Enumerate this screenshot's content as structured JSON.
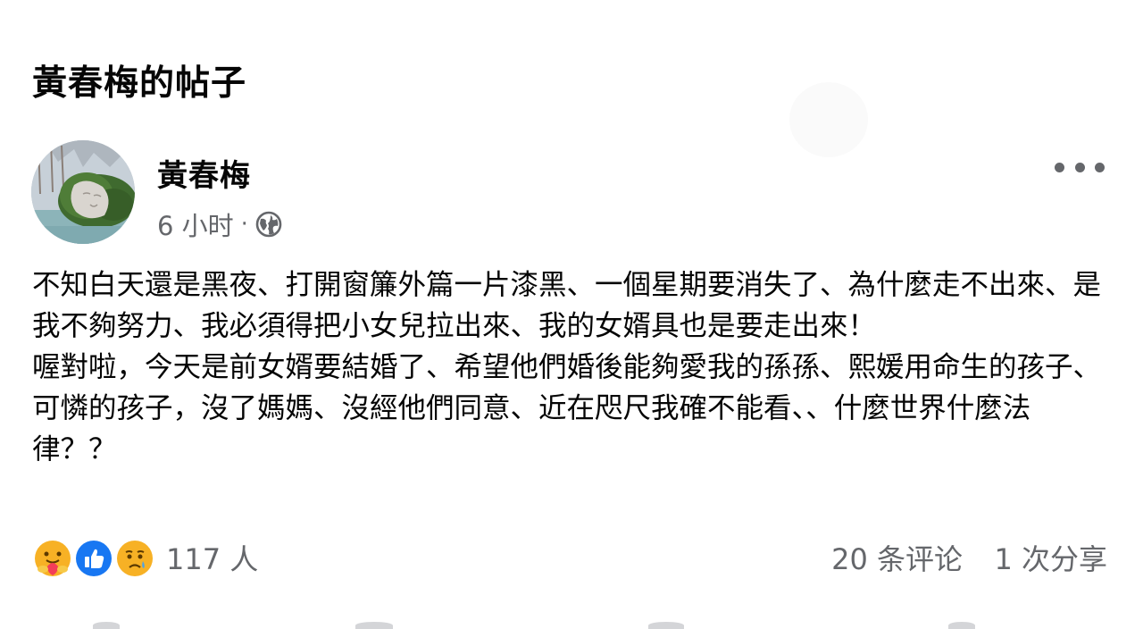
{
  "page": {
    "title": "黃春梅的帖子"
  },
  "post": {
    "author": "黃春梅",
    "time": "6 小时",
    "separator": "·",
    "audience_icon": "globe-icon",
    "more_icon": "more-dots-icon",
    "body": [
      "不知白天還是黑夜、打開窗簾外篇一片漆黑、一個星期要消失了、為什麼走不出來、是我不夠努力、我必須得把小女兒拉出來、我的女婿具也是要走出來！",
      "喔對啦，今天是前女婿要結婚了、希望他們婚後能夠愛我的孫孫、熙媛用命生的孩子、可憐的孩子，沒了媽媽、沒經他們同意、近在咫尺我確不能看、、什麼世界什麼法律？？"
    ]
  },
  "reactions": {
    "icons": [
      "care-reaction-icon",
      "like-reaction-icon",
      "sad-reaction-icon"
    ],
    "count": "117 人",
    "comments": "20 条评论",
    "shares": "1 次分享"
  },
  "colors": {
    "text_primary": "#050505",
    "text_secondary": "#65676b",
    "like_blue": "#1877f2",
    "reaction_yellow": "#f7b125"
  }
}
